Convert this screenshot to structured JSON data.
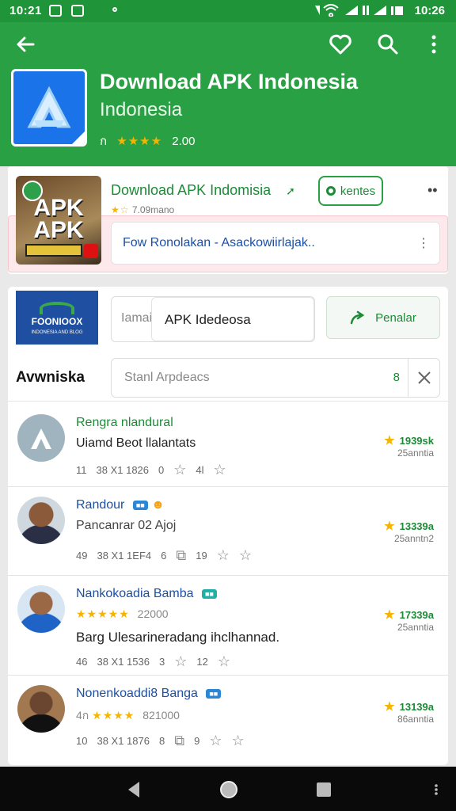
{
  "status_bar": {
    "time_left": "10:21",
    "time_right": "10:26"
  },
  "header": {
    "app_title": "Download APK Indonesia",
    "app_subtitle": "Indonesia",
    "meta_prefix": "ก",
    "stars": "★★★★",
    "rating": "2.00"
  },
  "featured": {
    "image_text_1": "APK",
    "image_text_2": "APK",
    "title": "Download APK Indomisia",
    "stars": "★☆",
    "meta": "7.09mano",
    "button_label": "kentes",
    "field_text": "Fow Ronolakan - Asackowiirlajak..",
    "field_icon": "⋮"
  },
  "search_section": {
    "brand_text": "FOONIOOX",
    "brand_small": "INDONESIA AND BLOG",
    "field_prefix": "Iamai",
    "field_value": "APK Idedeosa",
    "button_label": "Penalar",
    "section_label": "Avwniska",
    "search_placeholder": "Stanl Arpdeacs",
    "search_count": "8"
  },
  "reviews": [
    {
      "name": "Rengra nlandural",
      "subtitle": "Uiamd Beot llalantats",
      "meta": [
        "11",
        "38 X1 1826",
        "0",
        "4l"
      ],
      "score": "1939sk",
      "score_sub": "25anntia"
    },
    {
      "name": "Randour",
      "subtitle": "Pancanrar  02 Ajoj",
      "meta": [
        "49",
        "38 X1 1EF4",
        "6",
        "19"
      ],
      "score": "13339a",
      "score_sub": "25anntn2"
    },
    {
      "name": "Nankokoadia Bamba",
      "stars": "★★★★★",
      "rating": "22000",
      "text": "Barg Ulesarineradang ihclhannad.",
      "meta": [
        "46",
        "38 X1 1536",
        "3",
        "12"
      ],
      "score": "17339a",
      "score_sub": "25anntia"
    },
    {
      "name": "Nonenkoaddi8 Banga",
      "prefix": "4ก",
      "stars": "★★★★",
      "rating": "821000",
      "meta": [
        "10",
        "38 X1 1876",
        "8",
        "9"
      ],
      "score": "13139a",
      "score_sub": "86anntia"
    }
  ],
  "colors": {
    "primary": "#2aa044",
    "primary_dark": "#1f9438",
    "accent_star": "#f5b400",
    "link_blue": "#1d4fa3"
  },
  "icons": {
    "back": "back-arrow-icon",
    "favorite": "heart-icon",
    "search": "search-icon",
    "menu": "more-vert-icon"
  }
}
